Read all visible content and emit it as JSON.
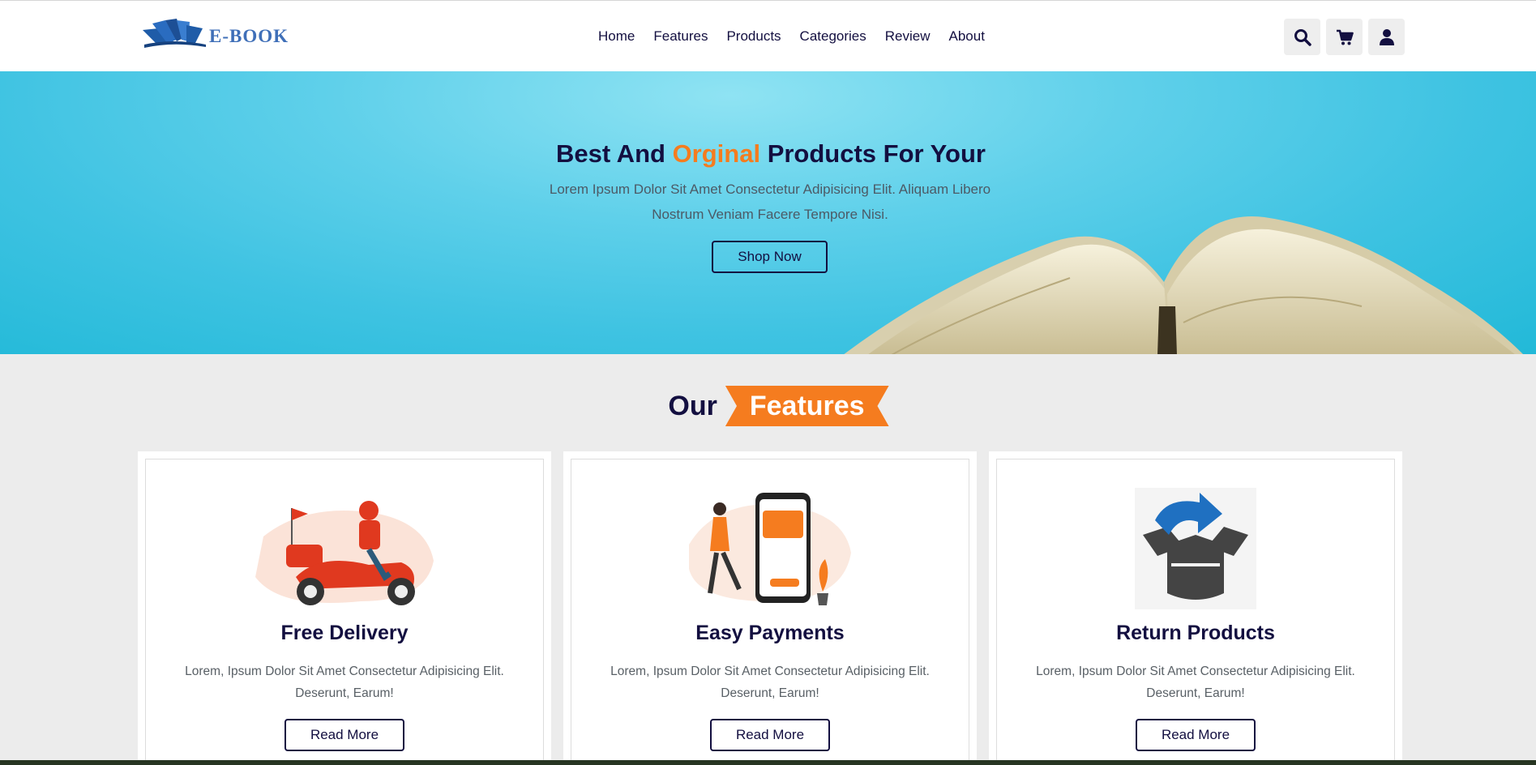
{
  "header": {
    "logo_text": "E-BOOK",
    "nav": [
      "Home",
      "Features",
      "Products",
      "Categories",
      "Review",
      "About"
    ],
    "icons": [
      "search-icon",
      "cart-icon",
      "user-icon"
    ]
  },
  "hero": {
    "title_part1": "Best And ",
    "title_highlight": "Orginal",
    "title_part2": " Products For Your",
    "subtitle": "Lorem Ipsum Dolor Sit Amet Consectetur Adipisicing Elit. Aliquam Libero Nostrum Veniam Facere Tempore Nisi.",
    "button": "Shop Now"
  },
  "features": {
    "heading_plain": "Our",
    "heading_badge": "Features",
    "cards": [
      {
        "title": "Free Delivery",
        "text": "Lorem, Ipsum Dolor Sit Amet Consectetur Adipisicing Elit. Deserunt, Earum!",
        "button": "Read More"
      },
      {
        "title": "Easy Payments",
        "text": "Lorem, Ipsum Dolor Sit Amet Consectetur Adipisicing Elit. Deserunt, Earum!",
        "button": "Read More"
      },
      {
        "title": "Return Products",
        "text": "Lorem, Ipsum Dolor Sit Amet Consectetur Adipisicing Elit. Deserunt, Earum!",
        "button": "Read More"
      }
    ]
  },
  "colors": {
    "accent": "#f57c1f",
    "primary": "#130f40",
    "hero_bg": "#3fc3e2"
  }
}
